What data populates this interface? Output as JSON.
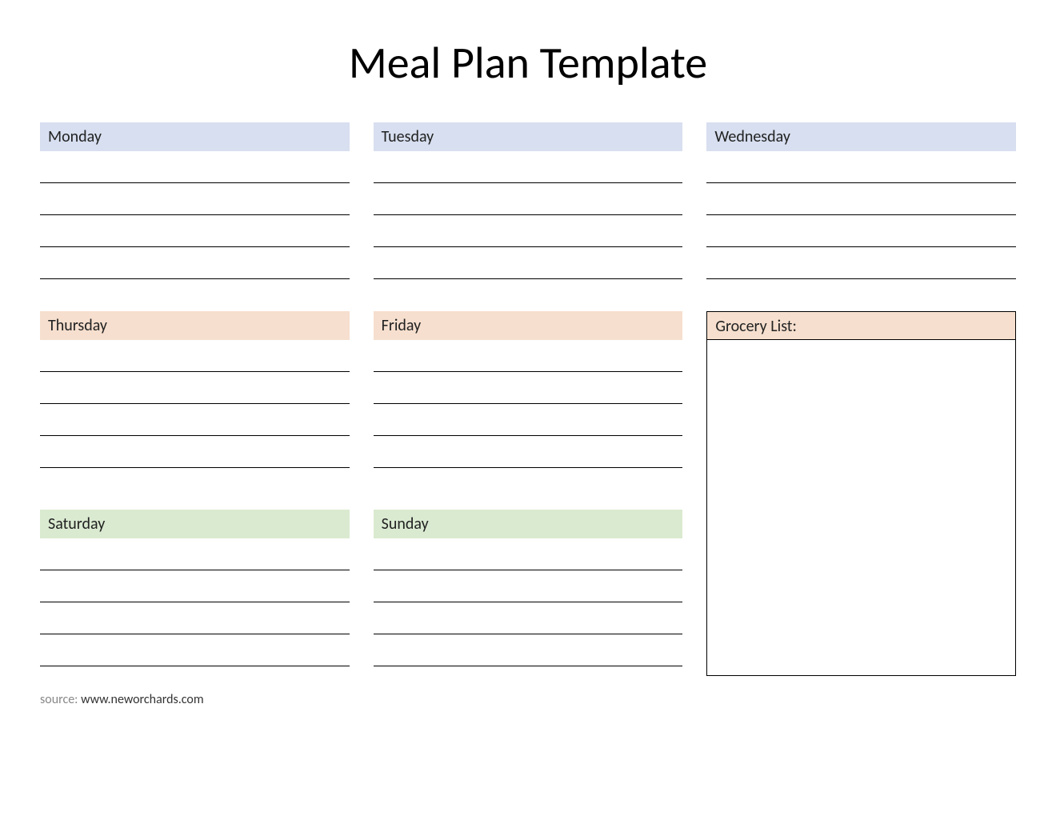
{
  "title": "Meal Plan Template",
  "days": {
    "monday": "Monday",
    "tuesday": "Tuesday",
    "wednesday": "Wednesday",
    "thursday": "Thursday",
    "friday": "Friday",
    "saturday": "Saturday",
    "sunday": "Sunday"
  },
  "grocery_list_label": "Grocery List:",
  "footer": {
    "source_label": "source: ",
    "source_url": "www.neworchards.com"
  },
  "colors": {
    "blue": "#d7dff0",
    "peach": "#f6dfce",
    "green": "#daead1"
  }
}
